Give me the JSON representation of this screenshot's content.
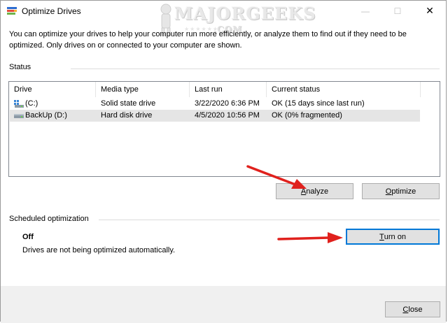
{
  "window": {
    "title": "Optimize Drives",
    "icon": "defrag-app-icon",
    "controls": {
      "minimize": "—",
      "maximize": "☐",
      "close": "✕"
    }
  },
  "watermark": {
    "text": "MAJORGEEKS",
    "sub": ".COM",
    "stars": "★★★★★★"
  },
  "description": "You can optimize your drives to help your computer run more efficiently, or analyze them to find out if they need to be optimized. Only drives on or connected to your computer are shown.",
  "status": {
    "label": "Status",
    "columns": [
      "Drive",
      "Media type",
      "Last run",
      "Current status"
    ],
    "rows": [
      {
        "drive": "(C:)",
        "icon": "system-drive-icon",
        "media": "Solid state drive",
        "last_run": "3/22/2020 6:36 PM",
        "status": "OK (15 days since last run)",
        "selected": false
      },
      {
        "drive": "BackUp (D:)",
        "icon": "hard-drive-icon",
        "media": "Hard disk drive",
        "last_run": "4/5/2020 10:56 PM",
        "status": "OK (0% fragmented)",
        "selected": true
      }
    ],
    "buttons": {
      "analyze": {
        "accel": "A",
        "rest": "nalyze"
      },
      "optimize": {
        "accel": "O",
        "rest": "ptimize"
      }
    }
  },
  "scheduled": {
    "label": "Scheduled optimization",
    "state": "Off",
    "description": "Drives are not being optimized automatically.",
    "button": {
      "accel": "T",
      "rest": "urn on"
    }
  },
  "footer": {
    "close": {
      "accel": "C",
      "rest": "lose"
    }
  },
  "colors": {
    "annotation_arrow": "#e0211d",
    "focus_border": "#0078d7",
    "button_bg": "#e1e1e1",
    "selection_bg": "#e5e5e5",
    "footer_bg": "#f0f0f0"
  }
}
